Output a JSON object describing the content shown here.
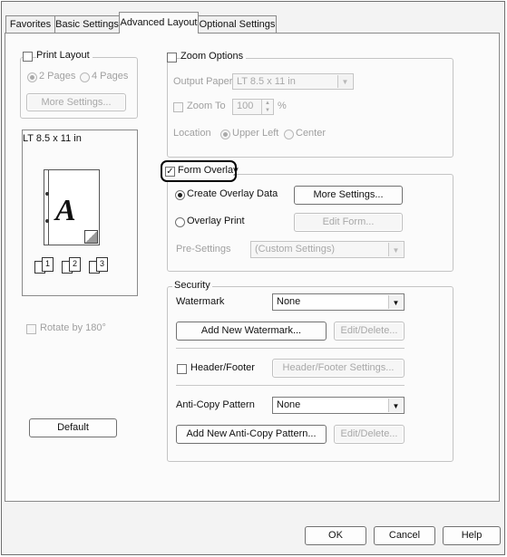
{
  "tabs": [
    {
      "label": "Favorites"
    },
    {
      "label": "Basic Settings"
    },
    {
      "label": "Advanced Layout"
    },
    {
      "label": "Optional Settings"
    }
  ],
  "print_layout": {
    "label": "Print Layout",
    "option_2_pages": "2 Pages",
    "option_4_pages": "4 Pages",
    "more_settings": "More Settings..."
  },
  "preview": {
    "paper": "LT 8.5 x 11 in",
    "page_letter": "A",
    "stack_digits": [
      "1",
      "2",
      "3"
    ]
  },
  "rotate": {
    "label": "Rotate by 180°"
  },
  "default_button": "Default",
  "zoom_options": {
    "label": "Zoom Options",
    "output_paper_label": "Output Paper",
    "output_paper_value": "LT 8.5 x 11 in",
    "zoom_to_label": "Zoom To",
    "zoom_value": "100",
    "percent": "%",
    "location_label": "Location",
    "upper_left": "Upper Left",
    "center": "Center"
  },
  "form_overlay": {
    "label": "Form Overlay",
    "create_overlay": "Create Overlay Data",
    "more_settings": "More Settings...",
    "overlay_print": "Overlay Print",
    "edit_form": "Edit Form...",
    "presettings_label": "Pre-Settings",
    "presettings_value": "(Custom Settings)"
  },
  "security": {
    "label": "Security",
    "watermark_label": "Watermark",
    "watermark_value": "None",
    "add_watermark": "Add New Watermark...",
    "edit_delete_1": "Edit/Delete...",
    "header_footer": "Header/Footer",
    "header_footer_settings": "Header/Footer Settings...",
    "anticopy_label": "Anti-Copy Pattern",
    "anticopy_value": "None",
    "add_anticopy": "Add New Anti-Copy Pattern...",
    "edit_delete_2": "Edit/Delete..."
  },
  "footer": {
    "ok": "OK",
    "cancel": "Cancel",
    "help": "Help"
  },
  "colors": {
    "highlight_ring": "#000000",
    "dialog_bg": "#f3f3f3"
  }
}
